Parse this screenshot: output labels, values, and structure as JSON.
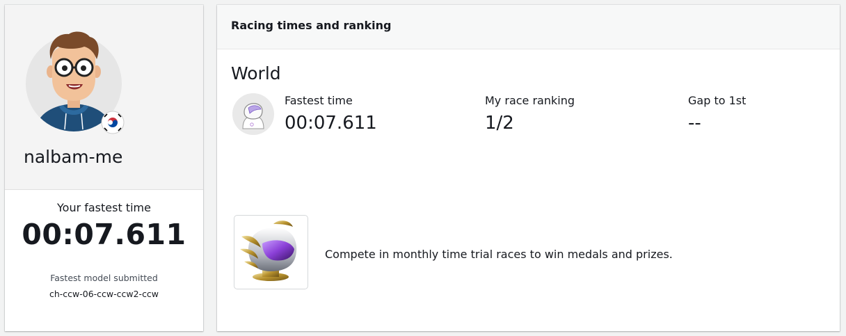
{
  "profile": {
    "username": "nalbam-me",
    "country_flag_icon": "south-korea-flag-icon",
    "avatar_icon": "cartoon-avatar-glasses",
    "fastest_time_label": "Your fastest time",
    "fastest_time_value": "00:07.611",
    "fastest_model_label": "Fastest model submitted",
    "fastest_model_name": "ch-ccw-06-ccw-ccw2-ccw"
  },
  "ranking": {
    "header_title": "Racing times and ranking",
    "section_title": "World",
    "racer_icon": "racer-helmet-icon",
    "stats": {
      "fastest_time_label": "Fastest time",
      "fastest_time_value": "00:07.611",
      "race_ranking_label": "My race ranking",
      "race_ranking_value": "1/2",
      "gap_label": "Gap to 1st",
      "gap_value": "--"
    },
    "promo": {
      "icon": "medal-helmet-trophy",
      "text": "Compete in monthly time trial races to win medals and prizes."
    }
  },
  "colors": {
    "page_background": "#f2f3f3",
    "card_background": "#ffffff",
    "header_background": "#f7f8f8",
    "text_primary": "#16191f",
    "helmet_visor": "#8a3fd6",
    "avatar_hoodie": "#1f4e79"
  }
}
